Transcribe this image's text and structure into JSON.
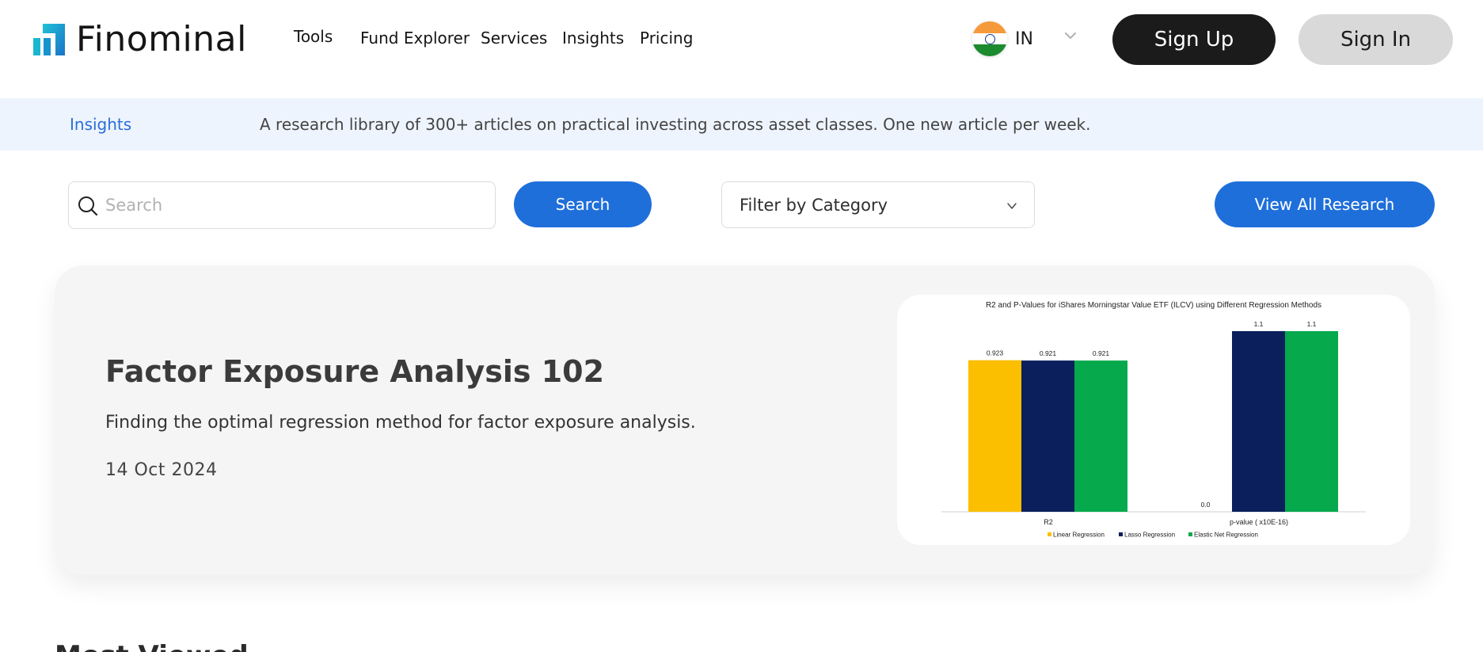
{
  "brand": {
    "name": "Finominal",
    "colors": {
      "accent": "#1f6fdb",
      "logo_teal": "#1ab0c8",
      "dark": "#1b1b1b",
      "infobar_bg": "#eef4fd"
    }
  },
  "nav": {
    "items": [
      "Tools",
      "Fund Explorer",
      "Services",
      "Insights",
      "Pricing"
    ]
  },
  "region": {
    "code": "IN",
    "flag_icon": "india-flag-icon"
  },
  "auth": {
    "signup_label": "Sign Up",
    "signin_label": "Sign In"
  },
  "infobar": {
    "label": "Insights",
    "text": "A research library of 300+ articles on practical investing across asset classes. One new article per week."
  },
  "controls": {
    "search_placeholder": "Search",
    "search_button": "Search",
    "filter_label": "Filter by Category",
    "view_all_button": "View All Research"
  },
  "featured": {
    "title": "Factor Exposure Analysis 102",
    "description": "Finding the optimal regression method for factor exposure analysis.",
    "date": "14 Oct 2024"
  },
  "chart_data": {
    "type": "bar",
    "title": "R2 and P-Values for iShares Morningstar Value ETF (ILCV) using Different Regression Methods",
    "categories": [
      "R2",
      "p-value ( x10E-16)"
    ],
    "series": [
      {
        "name": "Linear Regression",
        "values": [
          0.923,
          0.0
        ],
        "labels": [
          "0.923",
          "0.0"
        ],
        "color": "#fbbf00"
      },
      {
        "name": "Lasso Regression",
        "values": [
          0.921,
          1.1
        ],
        "labels": [
          "0.921",
          "1.1"
        ],
        "color": "#0a1f5c"
      },
      {
        "name": "Elastic Net Regression",
        "values": [
          0.921,
          1.1
        ],
        "labels": [
          "0.921",
          "1.1"
        ],
        "color": "#06a94c"
      }
    ],
    "ylim": [
      0,
      1.1
    ],
    "grid": false,
    "legend": "bottom"
  },
  "sections": {
    "most_viewed": "Most Viewed"
  }
}
